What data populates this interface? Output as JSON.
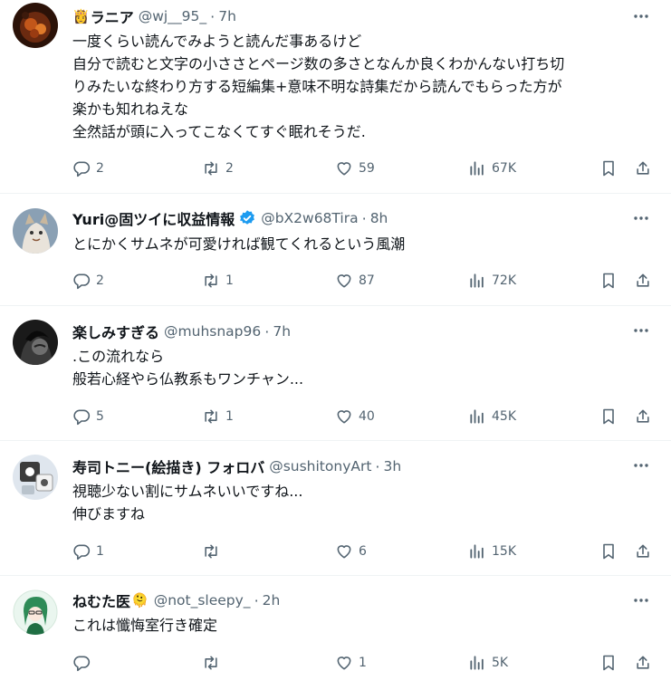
{
  "colors": {
    "text": "#0f1419",
    "muted": "#536471",
    "divider": "#eff3f4",
    "verified": "#1d9bf0"
  },
  "tweets": [
    {
      "name": "ラニア",
      "name_emoji": "👸",
      "handle": "@wj__95_",
      "time": "7h",
      "lines": [
        "一度くらい読んでみようと読んだ事あるけど",
        "自分で読むと文字の小ささとページ数の多さとなんか良くわかんない打ち切",
        "りみたいな終わり方する短編集+意味不明な詩集だから読んでもらった方が",
        "楽かも知れねえな",
        "全然話が頭に入ってこなくてすぐ眠れそうだ."
      ],
      "replies": "2",
      "retweets": "2",
      "likes": "59",
      "views": "67K"
    },
    {
      "name": "Yuri@固ツイに収益情報",
      "verified": true,
      "handle": "@bX2w68Tira",
      "time": "8h",
      "lines": [
        "とにかくサムネが可愛ければ観てくれるという風潮"
      ],
      "replies": "2",
      "retweets": "1",
      "likes": "87",
      "views": "72K"
    },
    {
      "name": "楽しみすぎる",
      "handle": "@muhsnap96",
      "time": "7h",
      "lines": [
        ".この流れなら",
        "般若心経やら仏教系もワンチャン..."
      ],
      "replies": "5",
      "retweets": "1",
      "likes": "40",
      "views": "45K"
    },
    {
      "name": "寿司トニー(絵描き) フォロバ",
      "handle": "@sushitonyArt",
      "time": "3h",
      "lines": [
        "視聴少ない割にサムネいいですね...",
        "伸びますね"
      ],
      "replies": "1",
      "retweets": "",
      "likes": "6",
      "views": "15K"
    },
    {
      "name": "ねむた医",
      "name_emoji": "🫠",
      "handle": "@not_sleepy_",
      "time": "2h",
      "lines": [
        "これは懺悔室行き確定"
      ],
      "replies": "",
      "retweets": "",
      "likes": "1",
      "views": "5K"
    }
  ]
}
